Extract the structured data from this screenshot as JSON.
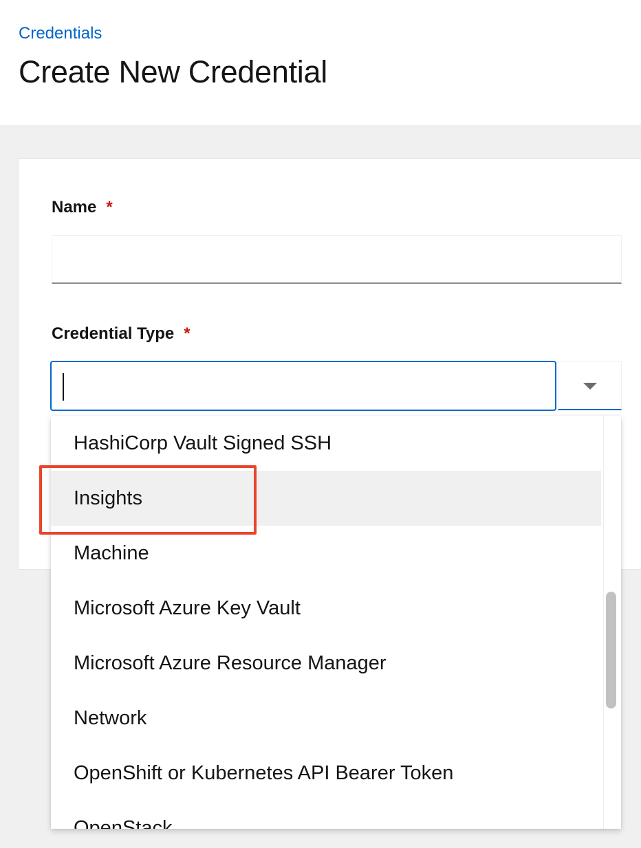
{
  "breadcrumb": {
    "link_label": "Credentials"
  },
  "page": {
    "title": "Create New Credential"
  },
  "form": {
    "name_field": {
      "label": "Name",
      "required_marker": "*",
      "value": ""
    },
    "credential_type_field": {
      "label": "Credential Type",
      "required_marker": "*",
      "value": ""
    }
  },
  "dropdown": {
    "items": [
      "HashiCorp Vault Signed SSH",
      "Insights",
      "Machine",
      "Microsoft Azure Key Vault",
      "Microsoft Azure Resource Manager",
      "Network",
      "OpenShift or Kubernetes API Bearer Token",
      "OpenStack"
    ],
    "hovered_item": "Insights"
  },
  "colors": {
    "link": "#0066cc",
    "required": "#c9190b",
    "focus_border": "#0066cc",
    "hover_background": "#f0f0f0",
    "annotation": "#e8452c"
  }
}
